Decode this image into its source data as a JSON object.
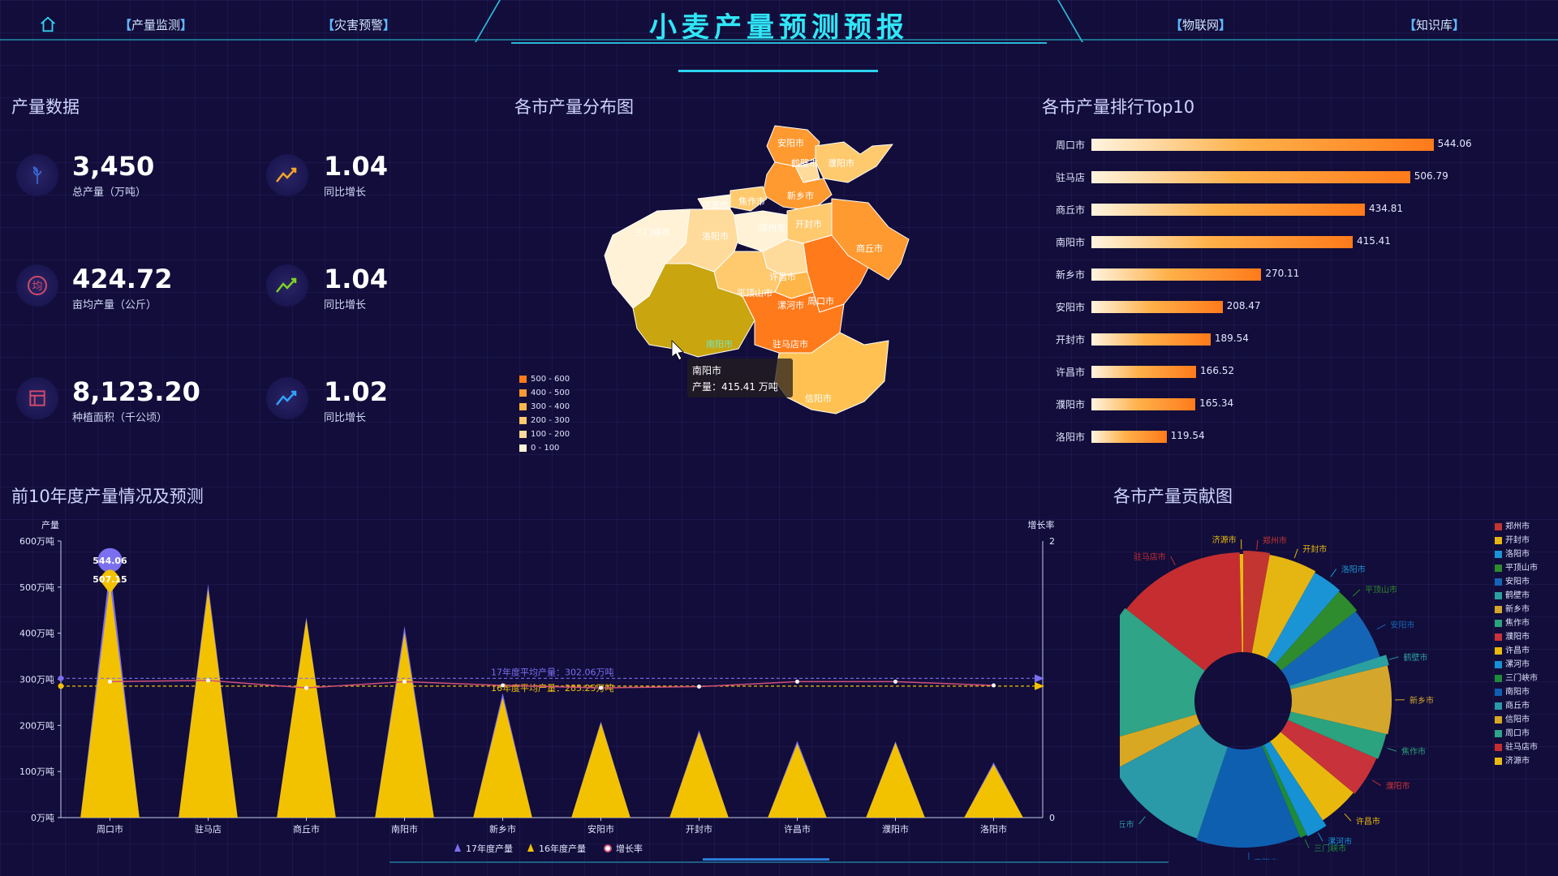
{
  "header": {
    "title": "小麦产量预测预报",
    "nav_left": [
      "产量监测",
      "灾害预警"
    ],
    "nav_right": [
      "物联网",
      "知识库"
    ],
    "accent": "#2fe7f7"
  },
  "sections": {
    "production": "产量数据",
    "map": "各市产量分布图",
    "top10": "各市产量排行Top10",
    "trend": "前10年度产量情况及预测",
    "pie": "各市产量贡献图"
  },
  "kpis": [
    {
      "icon": "wheat-icon",
      "value": "3,450",
      "label": "总产量（万吨）",
      "growth": "1.04",
      "growth_label": "同比增长",
      "color": "#f5a623"
    },
    {
      "icon": "average-icon",
      "value": "424.72",
      "label": "亩均产量（公斤）",
      "growth": "1.04",
      "growth_label": "同比增长",
      "color": "#7ed321"
    },
    {
      "icon": "area-icon",
      "value": "8,123.20",
      "label": "种植面积（千公顷）",
      "growth": "1.02",
      "growth_label": "同比增长",
      "color": "#2fa4ff"
    }
  ],
  "map": {
    "cities": [
      "安阳市",
      "濮阳市",
      "鹤壁市",
      "新乡市",
      "焦作市",
      "济源市",
      "三门峡市",
      "洛阳市",
      "郑州市",
      "开封市",
      "商丘市",
      "许昌市",
      "平顶山市",
      "漯河市",
      "周口市",
      "南阳市",
      "驻马店市",
      "信阳市"
    ],
    "tooltip": {
      "city": "南阳市",
      "label": "产量：415.41 万吨"
    },
    "legend": [
      "500 - 600",
      "400 - 500",
      "300 - 400",
      "200 - 300",
      "100 - 200",
      "0 - 100"
    ],
    "legend_colors": [
      "#ff7a1a",
      "#ff9a30",
      "#ffb648",
      "#ffc96e",
      "#ffdb9b",
      "#fff2d6"
    ]
  },
  "top10": [
    {
      "city": "周口市",
      "value": 544.06
    },
    {
      "city": "驻马店",
      "value": 506.79
    },
    {
      "city": "商丘市",
      "value": 434.81
    },
    {
      "city": "南阳市",
      "value": 415.41
    },
    {
      "city": "新乡市",
      "value": 270.11
    },
    {
      "city": "安阳市",
      "value": 208.47
    },
    {
      "city": "开封市",
      "value": 189.54
    },
    {
      "city": "许昌市",
      "value": 166.52
    },
    {
      "city": "濮阳市",
      "value": 165.34
    },
    {
      "city": "洛阳市",
      "value": 119.54
    }
  ],
  "chart_data": [
    {
      "type": "bar",
      "title": "前10年度产量情况及预测",
      "ylabel": "产量",
      "y2label": "增长率",
      "ylim": [
        0,
        600
      ],
      "y2lim": [
        0,
        2
      ],
      "yticks": [
        "0万吨",
        "100万吨",
        "200万吨",
        "300万吨",
        "400万吨",
        "500万吨",
        "600万吨"
      ],
      "categories": [
        "周口市",
        "驻马店",
        "商丘市",
        "南阳市",
        "新乡市",
        "安阳市",
        "开封市",
        "许昌市",
        "濮阳市",
        "洛阳市"
      ],
      "series": [
        {
          "name": "17年度产量",
          "values": [
            544.06,
            506.79,
            434.81,
            415.41,
            270.11,
            208.47,
            189.54,
            166.52,
            165.34,
            119.54
          ],
          "color": "#7b6ff0"
        },
        {
          "name": "16年度产量",
          "values": [
            507.15,
            495,
            430,
            400,
            260,
            205,
            185,
            160,
            162,
            115
          ],
          "color": "#f2c200"
        },
        {
          "name": "增长率",
          "values": [
            1.07,
            1.08,
            1.02,
            1.07,
            1.04,
            1.02,
            1.03,
            1.07,
            1.07,
            1.04
          ],
          "color": "#d2507a"
        }
      ],
      "markpoints": [
        "544.06",
        "507.15"
      ],
      "marklines": [
        {
          "label": "17年度平均产量：302.06万吨",
          "value": 302.06,
          "color": "#7b6ff0"
        },
        {
          "label": "16年度平均产量：285.25万吨",
          "value": 285.25,
          "color": "#f2c200"
        }
      ],
      "legend_position": "bottom"
    },
    {
      "type": "pie",
      "title": "各市产量贡献图",
      "slices": [
        {
          "name": "郑州市",
          "value": 3,
          "color": "#c23531"
        },
        {
          "name": "开封市",
          "value": 5.5,
          "color": "#e5b611"
        },
        {
          "name": "洛阳市",
          "value": 3.5,
          "color": "#1b94d6"
        },
        {
          "name": "平顶山市",
          "value": 3,
          "color": "#2e8b2e"
        },
        {
          "name": "安阳市",
          "value": 6,
          "color": "#1565b7"
        },
        {
          "name": "鹤壁市",
          "value": 1.2,
          "color": "#2aa0a0"
        },
        {
          "name": "新乡市",
          "value": 7.8,
          "color": "#d4a72c"
        },
        {
          "name": "焦作市",
          "value": 3,
          "color": "#2ba37f"
        },
        {
          "name": "濮阳市",
          "value": 4.8,
          "color": "#c8323a"
        },
        {
          "name": "许昌市",
          "value": 4.8,
          "color": "#e8b90c"
        },
        {
          "name": "漯河市",
          "value": 2.4,
          "color": "#1591d4"
        },
        {
          "name": "三门峡市",
          "value": 0.8,
          "color": "#1e8a3a"
        },
        {
          "name": "南阳市",
          "value": 12,
          "color": "#0f5fb0"
        },
        {
          "name": "商丘市",
          "value": 12.6,
          "color": "#2a99a8"
        },
        {
          "name": "信阳市",
          "value": 3.5,
          "color": "#d8a823"
        },
        {
          "name": "周口市",
          "value": 15.8,
          "color": "#2fa487"
        },
        {
          "name": "驻马店市",
          "value": 14.7,
          "color": "#c62d30"
        },
        {
          "name": "济源市",
          "value": 0.4,
          "color": "#e9bb10"
        }
      ],
      "legend_position": "right"
    }
  ]
}
